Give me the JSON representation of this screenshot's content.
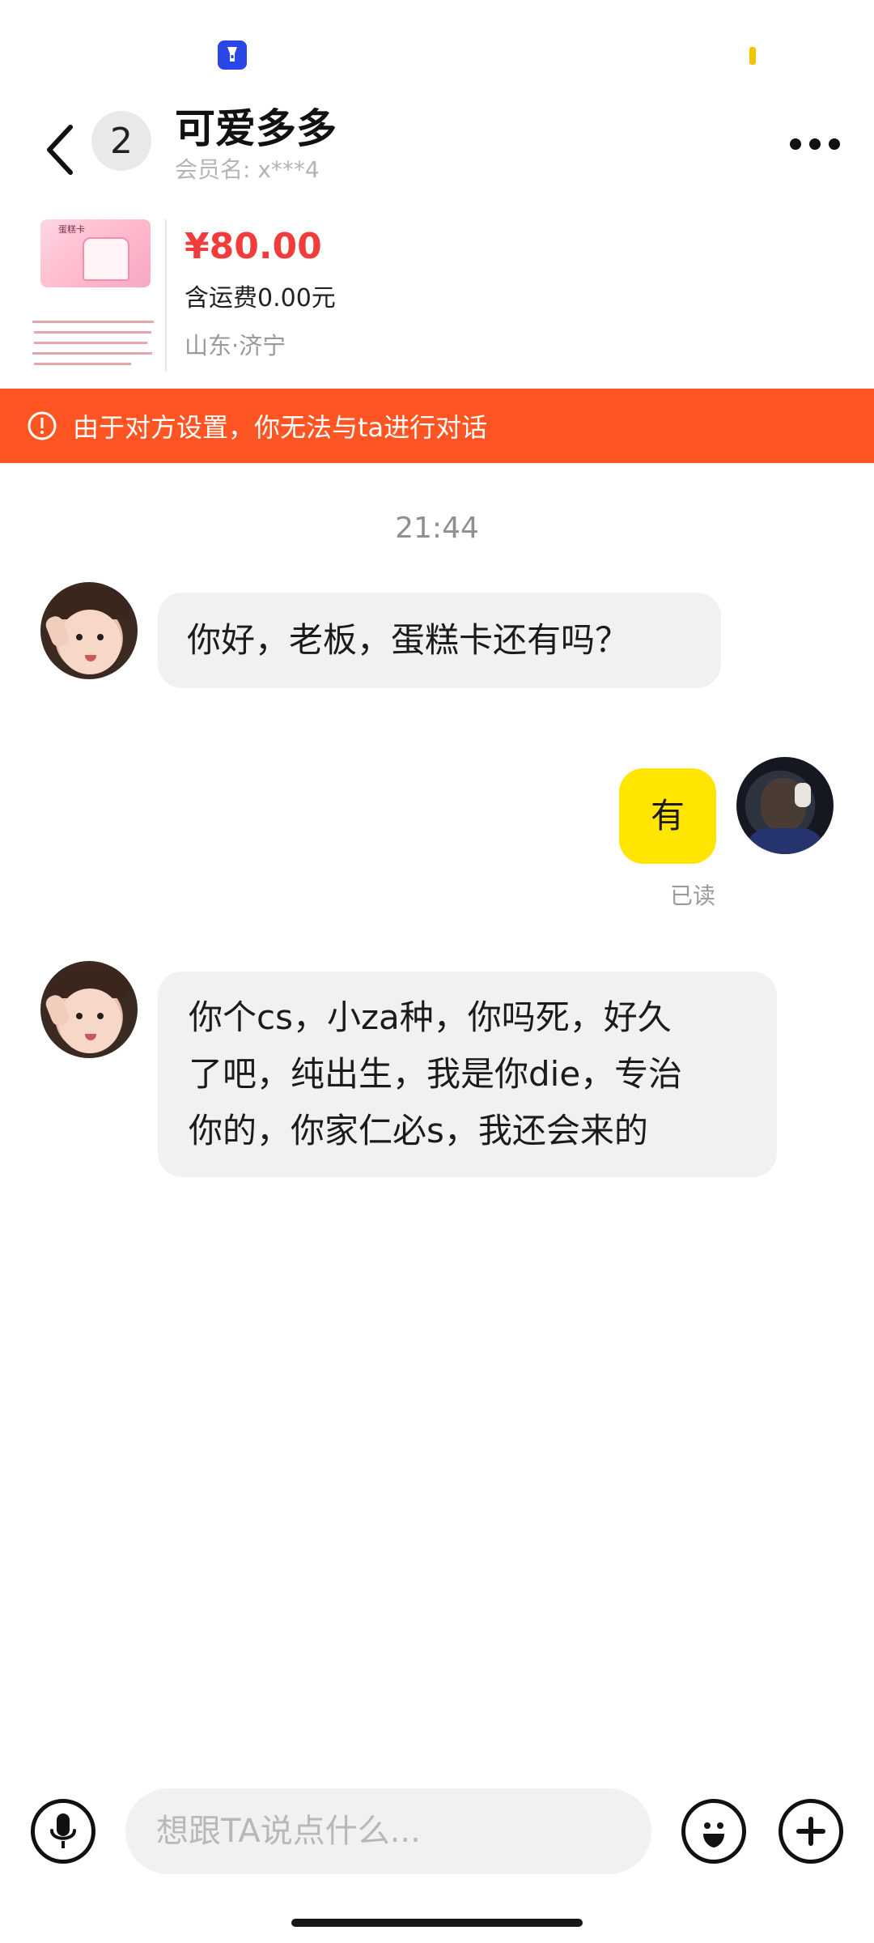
{
  "header": {
    "unread_count": "2",
    "title": "可爱多多",
    "member_label": "会员名:",
    "member_value": "x***4"
  },
  "product": {
    "thumb_title": "蛋糕卡",
    "price": "¥80.00",
    "shipping": "含运费0.00元",
    "location": "山东·济宁"
  },
  "warning": {
    "text": "由于对方设置，你无法与ta进行对话"
  },
  "chat": {
    "time": "21:44",
    "messages": [
      {
        "side": "left",
        "text": "你好，老板，蛋糕卡还有吗？"
      },
      {
        "side": "right",
        "text": "有",
        "status": "已读"
      },
      {
        "side": "left",
        "line1": "你个cs，小za种，你吗死，好久",
        "line2": "了吧，纯出生，我是你die，专治",
        "line3": "你的，你家仁必s，我还会来的"
      }
    ]
  },
  "composer": {
    "placeholder": "想跟TA说点什么..."
  },
  "colors": {
    "warning_bg": "#ff5523",
    "price": "#f23c3c",
    "self_bubble": "#ffe500",
    "other_bubble": "#f1f1f3"
  },
  "icons": [
    "flashlight-icon",
    "chevron-left-icon",
    "more-icon",
    "warning-icon",
    "microphone-icon",
    "emoji-icon",
    "plus-icon"
  ]
}
